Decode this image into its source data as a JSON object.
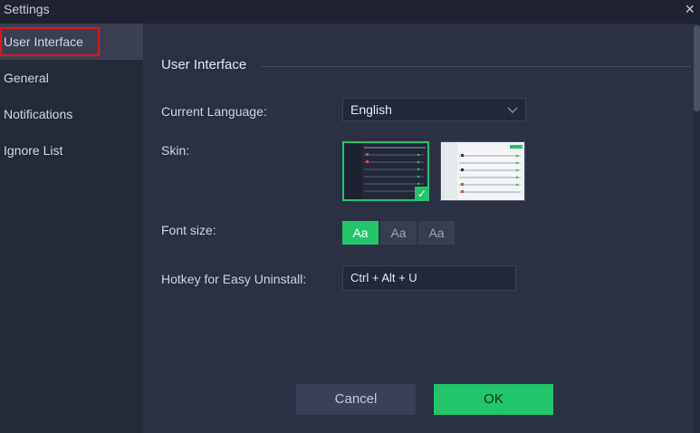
{
  "window": {
    "title": "Settings",
    "close_icon": "×"
  },
  "sidebar": {
    "items": [
      {
        "label": "User Interface",
        "active": true
      },
      {
        "label": "General"
      },
      {
        "label": "Notifications"
      },
      {
        "label": "Ignore List"
      }
    ]
  },
  "main": {
    "section_title": "User Interface",
    "language": {
      "label": "Current Language:",
      "value": "English"
    },
    "skin": {
      "label": "Skin:",
      "options": [
        "dark",
        "light"
      ],
      "selected": "dark"
    },
    "font_size": {
      "label": "Font size:",
      "options": [
        "Aa",
        "Aa",
        "Aa"
      ],
      "selected_index": 0
    },
    "hotkey": {
      "label": "Hotkey for Easy Uninstall:",
      "value": "Ctrl + Alt + U"
    }
  },
  "footer": {
    "cancel_label": "Cancel",
    "ok_label": "OK"
  },
  "colors": {
    "accent": "#22c56b",
    "background": "#2b3142",
    "sidebar": "#252a39",
    "highlight_border": "#e0161b"
  }
}
